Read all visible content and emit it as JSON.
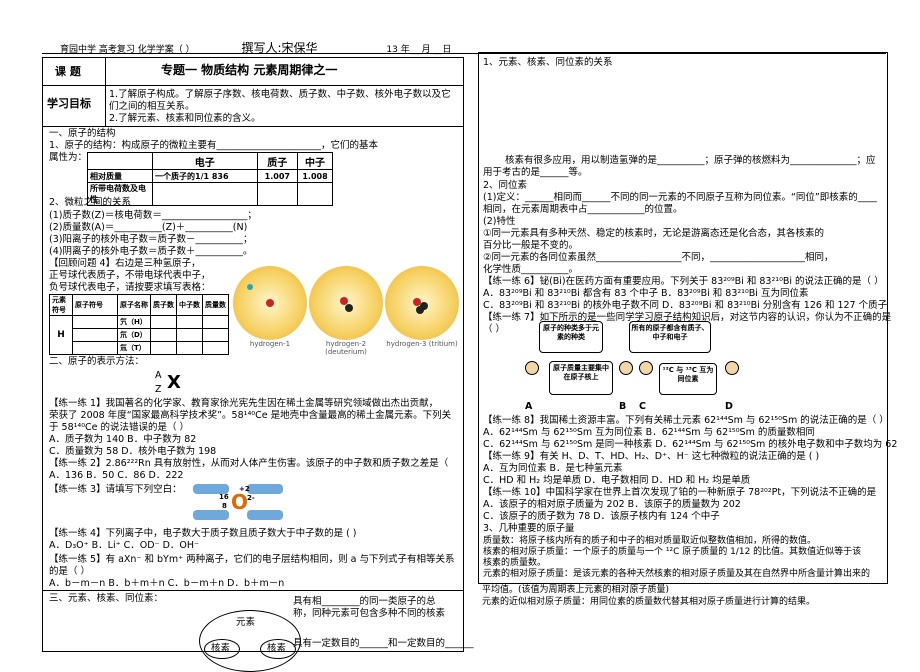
{
  "header": {
    "left": "育园中学  高考复习  化学学案（  ）",
    "middle": "撰写人:宋保华",
    "right": "13 年 __月 __日"
  },
  "course": {
    "label": "课  题",
    "title": "专题一  物质结构  元素周期律之一"
  },
  "goals": {
    "label": "学习目标",
    "lines": [
      "1.了解原子构成。了解原子序数、核电荷数、质子数、中子数、核外电子数以及它",
      "们之间的相互关系。",
      "2.了解元素、核素和同位素的含义。"
    ]
  },
  "left": {
    "s1": "一、原子的结构",
    "s1_1": "1、原子的结构：构成原子的微粒主要有______________________，它们的基本",
    "s1_1b": "属性为：",
    "table1": {
      "headers": [
        "",
        "电子",
        "质子",
        "中子"
      ],
      "rows": [
        [
          "相对质量",
          "一个质子的1/1 836",
          "1.007",
          "1.008"
        ],
        [
          "所带电荷数及电性",
          "",
          "",
          ""
        ]
      ]
    },
    "s2": "2、微粒之间的关系",
    "rel": [
      "(1)质子数(Z)＝核电荷数＝__________________；",
      "(2)质量数(A)＝__________(Z)＋__________(N)",
      "(3)阳离子的核外电子数＝质子数－__________；",
      "(4)阴离子的核外电子数＝质子数＋__________。"
    ],
    "review": [
      "【回顾问题 4】右边是三种氢原子，",
      "正号球代表质子，不带电球代表中子，",
      "负号球代表电子，请按要求填写表格："
    ],
    "table2": {
      "headers": [
        "元素符号",
        "原子符号",
        "原子名称",
        "质子数",
        "中子数",
        "质量数"
      ],
      "elem": "H",
      "names": [
        "氕（H）",
        "氘（D）",
        "氚（T）"
      ]
    },
    "orbs": [
      "hydrogen-1",
      "hydrogen-2 (deuterium)",
      "hydrogen-3 (tritium)"
    ],
    "s3": "二、原子的表示方法：",
    "symbol": "X",
    "az": [
      "A",
      "Z"
    ],
    "ex1": [
      "【练一练 1】我国著名的化学家、教育家徐光宪先生因在稀土金属等研究领域做出杰出贡献，",
      "荣获了 2008 年度“国家最高科学技术奖”。58¹⁴⁰Ce 是地壳中含量最高的稀土金属元素。下列关",
      "于 58¹⁴⁰Ce 的说法错误的是（    ）",
      "A．质子数为 140          B．中子数为 82",
      "C．质量数为 58           D．核外电子数为 198"
    ],
    "ex2": [
      "【练一练 2】2.86²²²Rn 具有放射性，从而对人体产生伤害。该原子的中子数和质子数之差是（",
      "A．136        B．50        C．86        D．222"
    ],
    "ex3": "【练一练 3】请填写下列空白：",
    "o_label": "O",
    "o_nums": [
      "16",
      "8",
      "+2",
      "2-"
    ],
    "ex4": [
      "【练一练 4】下列离子中，电子数大于质子数且质子数大于中子数的是          (       )",
      "A．D₃O⁺        B．Li⁺        C．OD⁻        D．OH⁻"
    ],
    "ex5": [
      "【练一练 5】有 aXn⁻ 和 bYm⁺ 两种离子，它们的电子层结构相同，则 a 与下列式子有相等关系",
      "的是（     ）",
      "A．b－m－n        B．b＋m＋n        C．b－m＋n        D．b＋m－n"
    ],
    "s4": "三、元素、核素、同位素：",
    "diag": {
      "center": "元素",
      "a": "核素",
      "b": "核素",
      "note1": [
        "具有相________的同一类原子的总",
        "称，同种元素可包含多种不同的核素"
      ],
      "note2": "具有一定数目的______和一定数目的______"
    }
  },
  "right": {
    "r1": "1、元素、核素、同位素的关系",
    "r2": [
      "核素有很多应用，用以制造氢弹的是__________；原子弹的核燃料为______________；应",
      "用于考古的是______等。"
    ],
    "r3": "2、同位素",
    "r4": [
      "(1)定义：______相同而______不同的同一元素的不同原子互称为同位素。“同位”即核素的____",
      "相同，在元素周期表中占____________的位置。"
    ],
    "r5": "(2)特性",
    "r6": [
      "①同一元素具有多种天然、稳定的核素时，无论是游离态还是化合态，其各核素的",
      "百分比一般是不变的。"
    ],
    "r7": [
      "②同一元素的各同位素虽然__________________不同，____________________相同，",
      "化学性质__________。"
    ],
    "ex6": [
      "【练一练 6】铋(Bi)在医药方面有重要应用。下列关于 83²⁰⁹Bi 和 83²¹⁰Bi 的说法正确的是（    ）",
      "A．83²⁰⁹Bi 和 83²¹⁰Bi 都含有 83 个中子        B．83²⁰⁹Bi 和 83²¹⁰Bi 互为同位素",
      "C．83²⁰⁹Bi 和 83²¹⁰Bi 的核外电子数不同      D．83²⁰⁹Bi 和 83²¹⁰Bi 分别含有 126 和 127 个质子"
    ],
    "ex7": [
      "【练一练 7】如下所示的是一些同学学习原子结构知识后，对这节内容的认识，你认为不正确的是",
      "（      ）"
    ],
    "bubbles": [
      "原子的种类多于元素的种类",
      "所有的原子都含有质子、中子和电子",
      "原子质量主要集中在原子核上",
      "¹²C 与 ¹³C 互为同位素"
    ],
    "abcd": [
      "A",
      "B",
      "C",
      "D"
    ],
    "ex8": [
      "【练一练 8】我国稀土资源丰富。下列有关稀土元素 62¹⁴⁴Sm 与 62¹⁵⁰Sm 的说法正确的是（    ）",
      "A．62¹⁴⁴Sm 与 62¹⁵⁰Sm 互为同位素            B．62¹⁴⁴Sm 与 62¹⁵⁰Sm 的质量数相同",
      "C．62¹⁴⁴Sm 与 62¹⁵⁰Sm 是同一种核素          D．62¹⁴⁴Sm 与 62¹⁵⁰Sm 的核外电子数和中子数均为 62"
    ],
    "ex9": [
      "【练一练 9】有关 H、D、T、HD、H₂、D⁺、H⁻ 这七种微粒的说法正确的是     (     )",
      "A．互为同位素                 B．是七种氢元素",
      "C．HD 和 H₂ 均是单质           D．电子数相同            D．HD 和 H₂ 均是单质"
    ],
    "ex10": [
      "【练一练 10】中国科学家在世界上首次发现了铂的一种新原子 78²⁰²Pt，下列说法不正确的是",
      "A．该原子的相对原子质量为 202      B．该原子的质量数为 202",
      "C．该原子的质子数为 78             D．该原子核内有 124 个中子"
    ],
    "r8": "3、几种重要的原子量",
    "r9": [
      "质量数：将原子核内所有的质子和中子的相对质量取近似整数值相加，所得的数值。",
      "核素的相对原子质量：一个原子的质量与一个 ¹²C 原子质量的 1/12 的比值。其数值近似等于该",
      "核素的质量数。",
      "元素的相对原子质量：是该元素的各种天然核素的相对原子质量及其在自然界中所含量计算出来的",
      "平均值。(该值为周期表上元素的相对原子质量)",
      "元素的近似相对原子质量：用同位素的质量数代替其相对原子质量进行计算的结果。"
    ]
  }
}
